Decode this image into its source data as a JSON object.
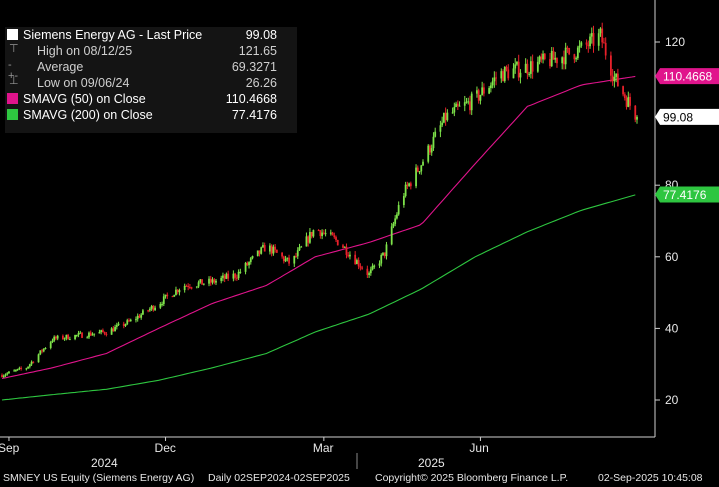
{
  "legend": {
    "security": "Siemens Energy AG - Last Price",
    "last_price": "99.08",
    "high_label": "High on 08/12/25",
    "high_value": "121.65",
    "average_label": "Average",
    "average_value": "69.3271",
    "low_label": "Low on 09/06/24",
    "low_value": "26.26",
    "sma50_label": "SMAVG (50)  on Close",
    "sma50_value": "110.4668",
    "sma200_label": "SMAVG (200)  on Close",
    "sma200_value": "77.4176"
  },
  "footer": {
    "ticker": "SMNEY US Equity (Siemens Energy AG)",
    "range": "Daily 02SEP2024-02SEP2025",
    "copyright": "Copyright© 2025 Bloomberg Finance L.P.",
    "timestamp": "02-Sep-2025 10:45:08"
  },
  "colors": {
    "up": "#7ee34a",
    "down": "#e8202a",
    "sma50": "#e0148c",
    "sma200": "#2ec640",
    "last_tag": "#ffffff"
  },
  "chart_data": {
    "type": "candlestick",
    "x_month_labels": [
      "Sep",
      "Dec",
      "Mar",
      "Jun"
    ],
    "x_year_labels": [
      "2024",
      "2025"
    ],
    "y_ticks": [
      20,
      40,
      60,
      80,
      120
    ],
    "ylim": [
      16,
      127
    ],
    "last_price": 99.08,
    "series": [
      {
        "name": "Last Price",
        "points": [
          [
            "2024-09-02",
            27
          ],
          [
            "2024-09-16",
            29
          ],
          [
            "2024-10-01",
            37
          ],
          [
            "2024-10-15",
            38
          ],
          [
            "2024-11-01",
            39
          ],
          [
            "2024-11-15",
            42
          ],
          [
            "2024-12-01",
            47
          ],
          [
            "2024-12-15",
            52
          ],
          [
            "2025-01-01",
            53
          ],
          [
            "2025-01-15",
            55
          ],
          [
            "2025-02-01",
            63
          ],
          [
            "2025-02-15",
            58
          ],
          [
            "2025-03-01",
            68
          ],
          [
            "2025-03-15",
            64
          ],
          [
            "2025-04-01",
            55
          ],
          [
            "2025-04-10",
            61
          ],
          [
            "2025-04-20",
            77
          ],
          [
            "2025-05-01",
            86
          ],
          [
            "2025-05-15",
            99
          ],
          [
            "2025-06-01",
            104
          ],
          [
            "2025-06-15",
            111
          ],
          [
            "2025-07-01",
            113
          ],
          [
            "2025-07-15",
            115
          ],
          [
            "2025-08-01",
            118
          ],
          [
            "2025-08-12",
            121.65
          ],
          [
            "2025-08-20",
            110
          ],
          [
            "2025-09-02",
            99.08
          ]
        ]
      },
      {
        "name": "SMAVG (50)  on Close",
        "last": 110.4668,
        "points": [
          [
            "2024-09-02",
            26
          ],
          [
            "2024-10-01",
            29
          ],
          [
            "2024-11-01",
            33
          ],
          [
            "2024-12-01",
            40
          ],
          [
            "2025-01-01",
            47
          ],
          [
            "2025-02-01",
            52
          ],
          [
            "2025-03-01",
            60
          ],
          [
            "2025-04-01",
            64
          ],
          [
            "2025-05-01",
            69
          ],
          [
            "2025-06-01",
            86
          ],
          [
            "2025-07-01",
            102
          ],
          [
            "2025-08-01",
            108
          ],
          [
            "2025-09-02",
            110.4668
          ]
        ]
      },
      {
        "name": "SMAVG (200)  on Close",
        "last": 77.4176,
        "points": [
          [
            "2024-09-02",
            20
          ],
          [
            "2024-10-01",
            21.5
          ],
          [
            "2024-11-01",
            23
          ],
          [
            "2024-12-01",
            25.5
          ],
          [
            "2025-01-01",
            29
          ],
          [
            "2025-02-01",
            33
          ],
          [
            "2025-03-01",
            39
          ],
          [
            "2025-04-01",
            44
          ],
          [
            "2025-05-01",
            51
          ],
          [
            "2025-06-01",
            60
          ],
          [
            "2025-07-01",
            67
          ],
          [
            "2025-08-01",
            73
          ],
          [
            "2025-09-02",
            77.4176
          ]
        ]
      }
    ]
  }
}
